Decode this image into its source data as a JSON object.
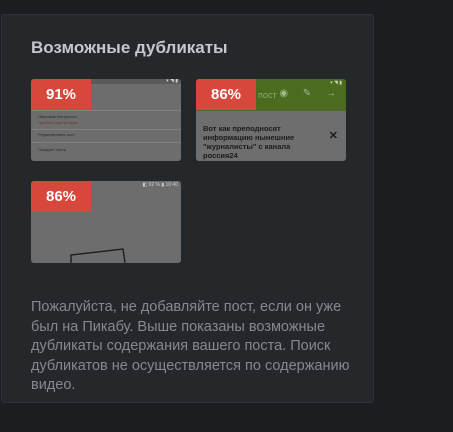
{
  "panel": {
    "title": "Возможные дубликаты",
    "notice": "Пожалуйста, не добавляйте пост, если он уже был на Пикабу. Выше показаны возможные дубликаты содержания вашего поста. Поиск дубликатов не осуществляется по содержанию видео."
  },
  "duplicates": [
    {
      "percent": "91%",
      "thumb_lines": [
        "Черновик  Интересно",
        "Пройти к настройкам",
        "Редактировать пост",
        "Ожидает поста"
      ],
      "status_icons": "▾ ◥ ▮"
    },
    {
      "percent": "86%",
      "thumb_top_label": "пост",
      "thumb_top_icons": "◉ ✎ →",
      "thumb_body_text": "Вот как преподносят\nинформацию нынешние\n\"журналисты\" с канала\nроссия24",
      "thumb_close": "✕",
      "status_icons": "▾ ◥ ▮"
    },
    {
      "percent": "86%",
      "status_icons": "◧ 92 % ▮ 10:40"
    }
  ],
  "colors": {
    "badge": "#d8473b",
    "panel_bg": "#25282b",
    "page_bg": "#1b1e21",
    "title": "#c4c8cc",
    "notice": "#85898e"
  }
}
